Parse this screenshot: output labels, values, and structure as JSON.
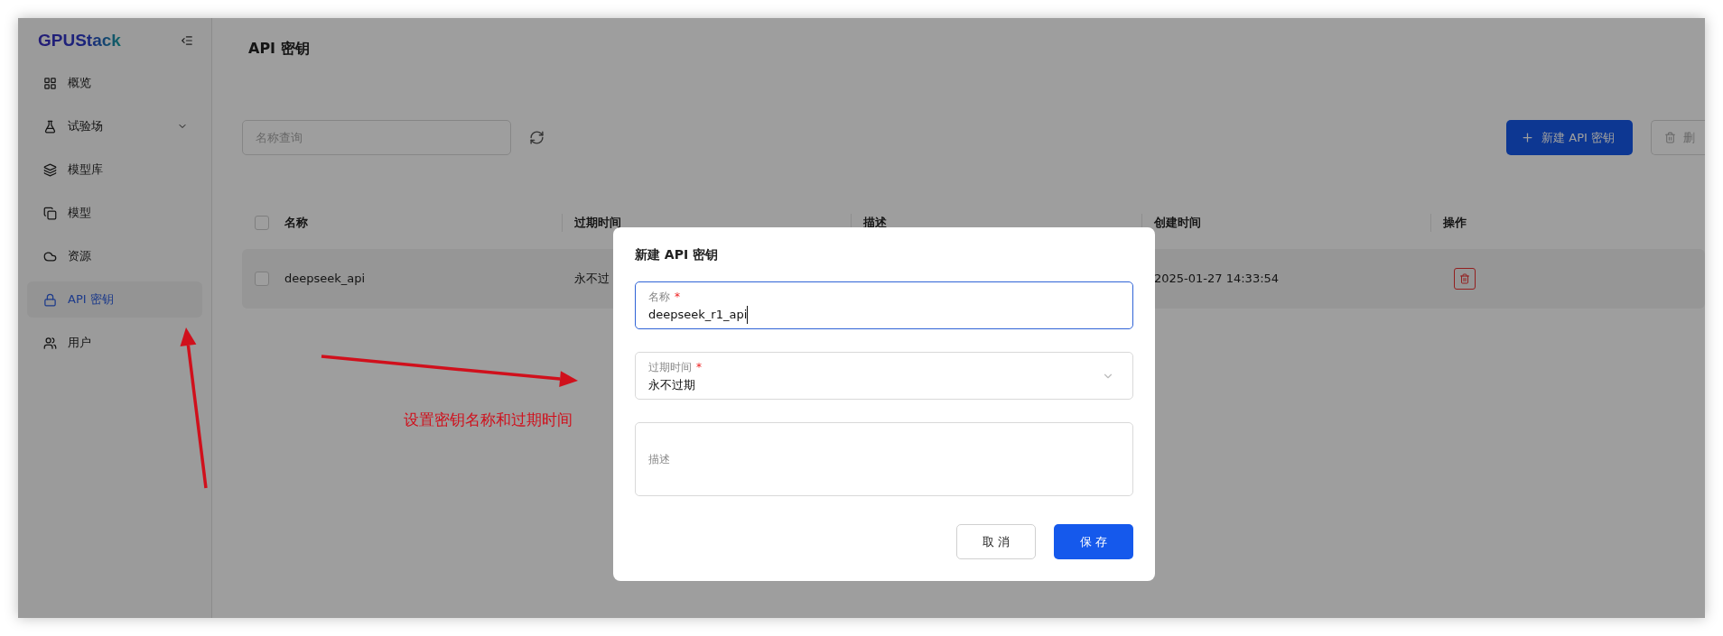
{
  "sidebar": {
    "logo": "GPUStack",
    "items": [
      {
        "label": "概览",
        "selected": false,
        "expandable": false
      },
      {
        "label": "试验场",
        "selected": false,
        "expandable": true
      },
      {
        "label": "模型库",
        "selected": false,
        "expandable": false
      },
      {
        "label": "模型",
        "selected": false,
        "expandable": false
      },
      {
        "label": "资源",
        "selected": false,
        "expandable": false
      },
      {
        "label": "API 密钥",
        "selected": true,
        "expandable": false
      },
      {
        "label": "用户",
        "selected": false,
        "expandable": false
      }
    ]
  },
  "page": {
    "title": "API 密钥",
    "search": {
      "placeholder": "名称查询"
    },
    "buttons": [
      {
        "kind": "primary",
        "label": "新建 API 密钥"
      },
      {
        "kind": "danger",
        "label": "删"
      }
    ]
  },
  "table": {
    "header_checked": false,
    "columns": [
      "名称",
      "过期时间",
      "描述",
      "创建时间",
      "操作"
    ],
    "rows": [
      {
        "checked": false,
        "name": "deepseek_api",
        "expires": "永不过",
        "created": "2025-01-27 14:33:54"
      }
    ]
  },
  "modal": {
    "title": "新建 API 密钥",
    "fields": [
      {
        "kind": "input",
        "label": "名称",
        "required_mark": "*",
        "value": "deepseek_r1_api",
        "focused": true
      },
      {
        "kind": "select",
        "label": "过期时间",
        "required_mark": "*",
        "value": "永不过期",
        "focused": false
      },
      {
        "kind": "textarea",
        "placeholder": "描述",
        "focused": false
      }
    ],
    "buttons": [
      {
        "kind": "default",
        "label": "取 消"
      },
      {
        "kind": "primary",
        "label": "保 存"
      }
    ]
  },
  "annotation": {
    "text": "设置密钥名称和过期时间"
  }
}
